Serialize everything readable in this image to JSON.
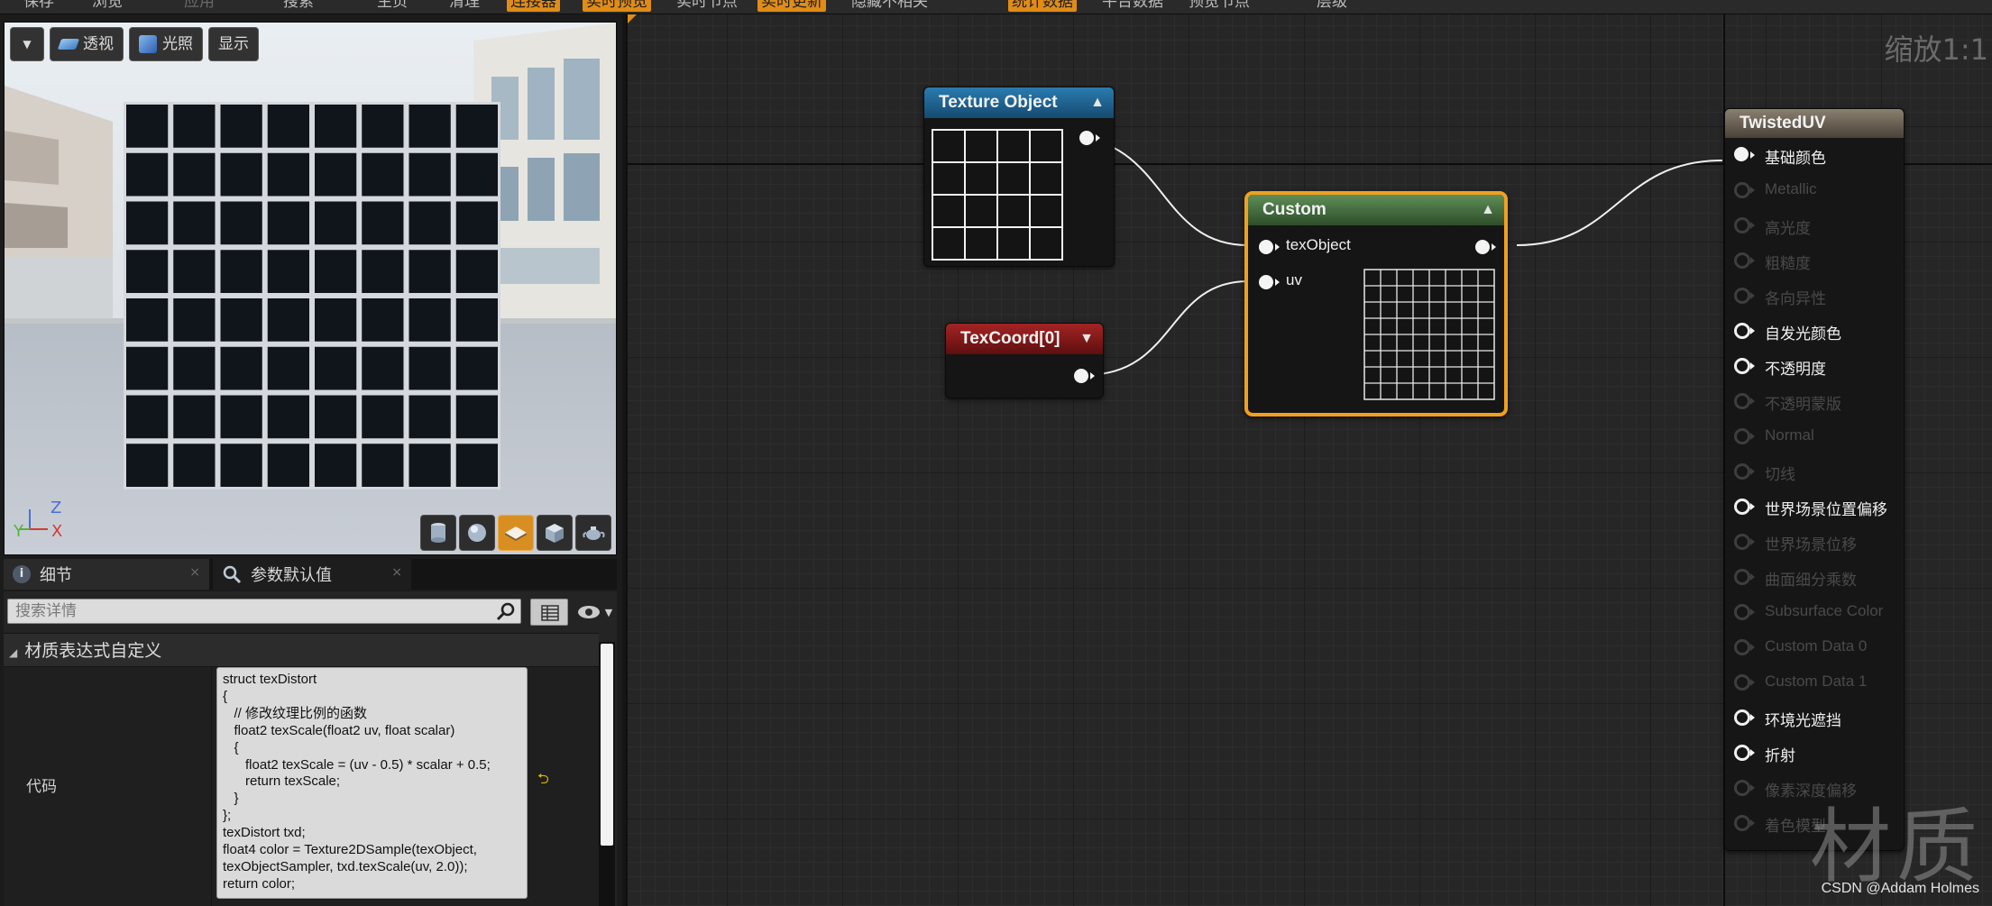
{
  "toolbar": {
    "items": [
      "保存",
      "浏览",
      "应用",
      "搜索",
      "主页",
      "清理",
      "连接器",
      "实时预览",
      "实时节点",
      "实时更新",
      "隐藏不相关",
      "统计数据",
      "平台数据",
      "预览节点",
      "层级"
    ]
  },
  "viewport": {
    "menu_button": "▼",
    "perspective_label": "透视",
    "lit_label": "光照",
    "show_label": "显示",
    "axis_z": "Z",
    "axis_y": "Y",
    "axis_x": "X",
    "checker_cols": 8,
    "checker_rows": 8
  },
  "tabs": {
    "details_label": "细节",
    "param_defaults_label": "参数默认值"
  },
  "details": {
    "search_placeholder": "搜索详情",
    "category_label": "材质表达式自定义",
    "code_label": "代码",
    "code_text": "struct texDistort\n{\n   // 修改纹理比例的函数\n   float2 texScale(float2 uv, float scalar)\n   {\n      float2 texScale = (uv - 0.5) * scalar + 0.5;\n      return texScale;\n   }\n};\ntexDistort txd;\nfloat4 color = Texture2DSample(texObject,\ntexObjectSampler, txd.texScale(uv, 2.0));\nreturn color;",
    "reset_symbol": "⮌"
  },
  "graph": {
    "zoom_label": "缩放1:1",
    "watermark": "材质",
    "credit": "CSDN @Addam Holmes",
    "texture_object_title": "Texture Object",
    "texcoord_title": "TexCoord[0]",
    "custom_title": "Custom",
    "custom_input_tex": "texObject",
    "custom_input_uv": "uv",
    "result_title": "TwistedUV",
    "result_pins": [
      {
        "label": "基础颜色",
        "active": true,
        "connected": true
      },
      {
        "label": "Metallic",
        "active": false,
        "connected": false
      },
      {
        "label": "高光度",
        "active": false,
        "connected": false
      },
      {
        "label": "粗糙度",
        "active": false,
        "connected": false
      },
      {
        "label": "各向异性",
        "active": false,
        "connected": false
      },
      {
        "label": "自发光颜色",
        "active": true,
        "connected": false
      },
      {
        "label": "不透明度",
        "active": true,
        "connected": false
      },
      {
        "label": "不透明蒙版",
        "active": false,
        "connected": false
      },
      {
        "label": "Normal",
        "active": false,
        "connected": false
      },
      {
        "label": "切线",
        "active": false,
        "connected": false
      },
      {
        "label": "世界场景位置偏移",
        "active": true,
        "connected": false
      },
      {
        "label": "世界场景位移",
        "active": false,
        "connected": false
      },
      {
        "label": "曲面细分乘数",
        "active": false,
        "connected": false
      },
      {
        "label": "Subsurface Color",
        "active": false,
        "connected": false
      },
      {
        "label": "Custom Data 0",
        "active": false,
        "connected": false
      },
      {
        "label": "Custom Data 1",
        "active": false,
        "connected": false
      },
      {
        "label": "环境光遮挡",
        "active": true,
        "connected": false
      },
      {
        "label": "折射",
        "active": true,
        "connected": false
      },
      {
        "label": "像素深度偏移",
        "active": false,
        "connected": false
      },
      {
        "label": "着色模型",
        "active": false,
        "connected": false
      }
    ]
  },
  "colors": {
    "accent_orange": "#e08c17",
    "texture_header": "#1f6a9a",
    "texcoord_header": "#8a1a1a",
    "custom_header": "#4d7a48",
    "result_header": "#6d6457",
    "selection_outline": "#f0a020"
  }
}
